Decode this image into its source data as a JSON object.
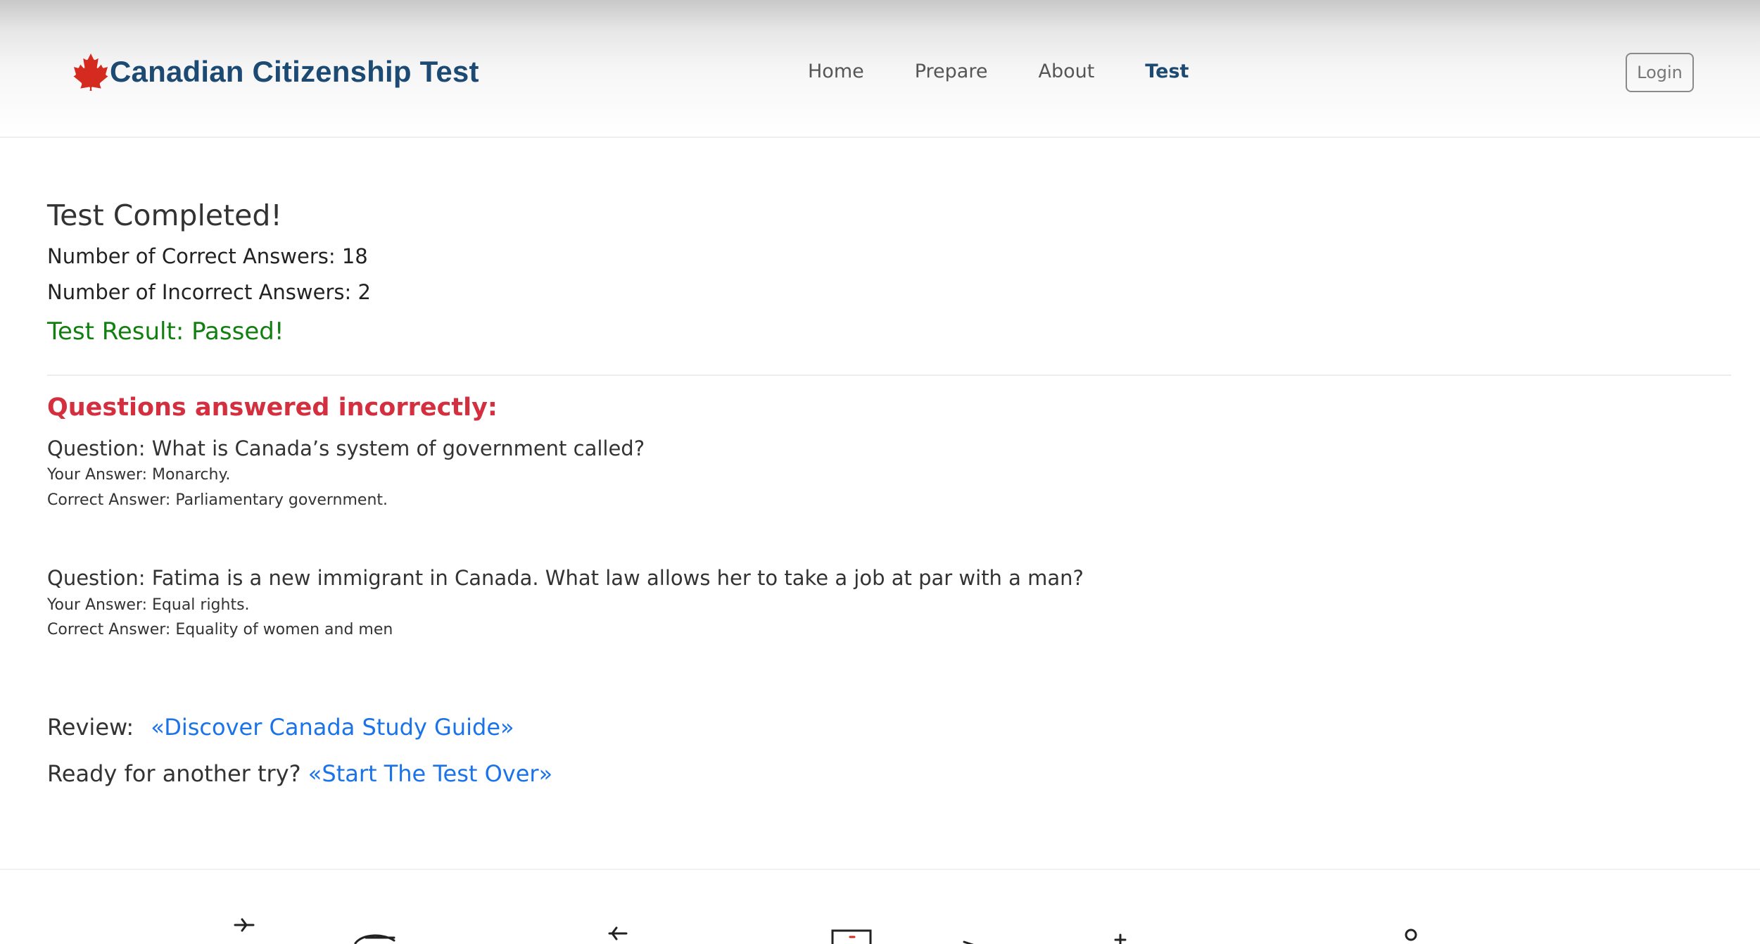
{
  "header": {
    "brand": "Canadian Citizenship Test",
    "nav": [
      {
        "label": "Home",
        "active": false
      },
      {
        "label": "Prepare",
        "active": false
      },
      {
        "label": "About",
        "active": false
      },
      {
        "label": "Test",
        "active": true
      }
    ],
    "login_label": "Login",
    "brand_color": "#1c4a72",
    "maple_color": "#d52b1e"
  },
  "results": {
    "title": "Test Completed!",
    "correct_line": "Number of Correct Answers: 18",
    "incorrect_line": "Number of Incorrect Answers: 2",
    "result_line": "Test Result: Passed!",
    "result_color": "#118011"
  },
  "incorrect": {
    "heading": "Questions answered incorrectly:",
    "heading_color": "#d32f3f",
    "items": [
      {
        "question": "Question: What is Canada’s system of government called?",
        "your_answer": "Your Answer: Monarchy.",
        "correct_answer": "Correct Answer: Parliamentary government."
      },
      {
        "question": "Question: Fatima is a new immigrant in Canada. What law allows her to take a job at par with a man?",
        "your_answer": "Your Answer: Equal rights.",
        "correct_answer": "Correct Answer: Equality of women and men"
      }
    ]
  },
  "links": {
    "review_label": "Review:",
    "review_link": "«Discover Canada Study Guide»",
    "retry_label": "Ready for another try?",
    "retry_link": "«Start The Test Over»",
    "link_color": "#1a73e8"
  },
  "icons": [
    "maple-leaf-icon"
  ]
}
